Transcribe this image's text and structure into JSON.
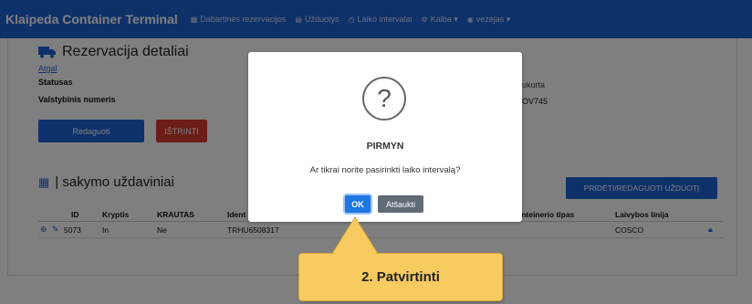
{
  "navbar": {
    "brand": "Klaipeda Container Terminal",
    "items": [
      {
        "icon": "calendar-icon",
        "label": "Dabartinės rezervacijos",
        "glyph": "▦"
      },
      {
        "icon": "list-icon",
        "label": "Užduotys",
        "glyph": "▤"
      },
      {
        "icon": "clock-icon",
        "label": "Laiko intervalai",
        "glyph": "◷"
      },
      {
        "icon": "gear-icon",
        "label": "Kalba ▾",
        "glyph": "⚙"
      },
      {
        "icon": "user-icon",
        "label": "vezejas ▾",
        "glyph": "◉"
      }
    ]
  },
  "reservation": {
    "title": "Rezervacija detaliai",
    "back_link": "Atgal",
    "status_label": "Statusas",
    "plate_label": "Valstybinis numeris",
    "created_label_partial": "ukurta",
    "plate_value_partial": "OV745",
    "edit_button": "Redaguoti",
    "delete_button": "IŠTRINTI"
  },
  "tasks": {
    "title": "| sakymo uždaviniai",
    "add_button": "PRIDĖTI/REDAGUOTI UŽDUOTĮ",
    "columns": [
      "ID",
      "Kryptis",
      "KRAUTAS",
      "Ident",
      "onteinerio tipas",
      "Laivybos linija"
    ],
    "rows": [
      {
        "id": "5073",
        "direction": "In",
        "cargo": "Ne",
        "ident": "TRHU6508317",
        "type": "",
        "line": "COSCO"
      }
    ]
  },
  "modal": {
    "icon": "question-icon",
    "glyph": "?",
    "title": "PIRMYN",
    "text": "Ar tikrai norite pasirinkti laiko intervalą?",
    "ok": "OK",
    "cancel": "Atšaukti"
  },
  "callout": {
    "text": "2. Patvirtinti",
    "color": "#f7cb5f"
  }
}
